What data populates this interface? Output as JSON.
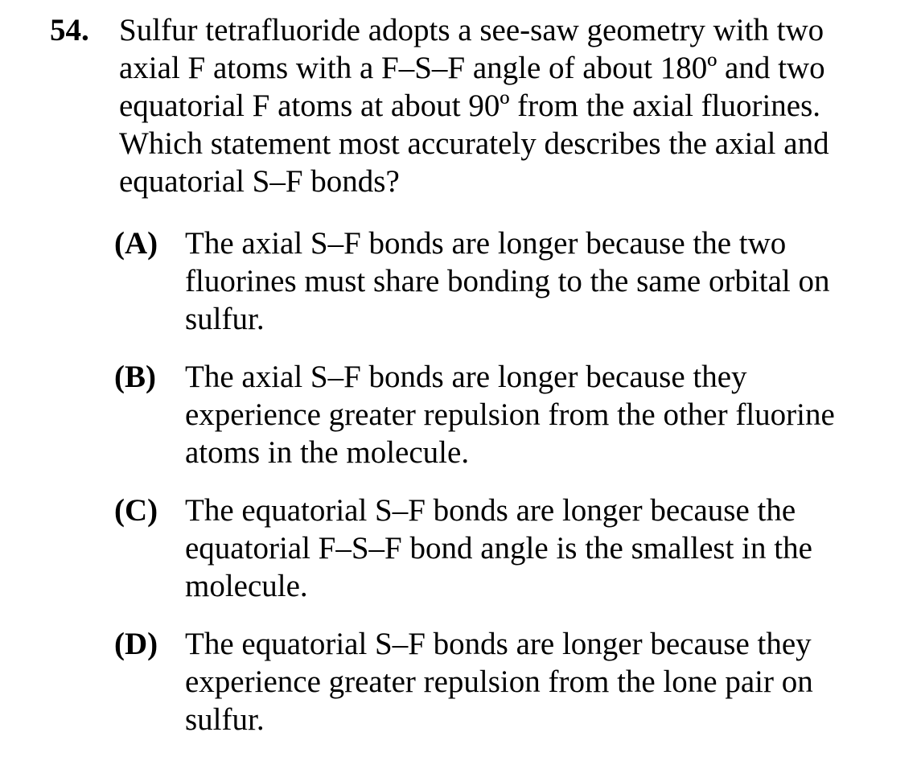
{
  "question": {
    "number": "54.",
    "stem_lines": [
      "Sulfur tetrafluoride adopts a see-saw geometry with two",
      "axial F atoms with a F–S–F angle of about 180º and two",
      "equatorial F atoms at about 90º from the axial fluorines.",
      "Which statement most accurately describes the axial and",
      "equatorial S–F bonds?"
    ]
  },
  "choices": [
    {
      "letter": "(A)",
      "lines": [
        "The axial S–F bonds are longer because the two",
        "fluorines must share bonding to the same orbital on",
        "sulfur."
      ]
    },
    {
      "letter": "(B)",
      "lines": [
        "The axial S–F bonds are longer because they",
        "experience greater repulsion from the other fluorine",
        "atoms in the molecule."
      ]
    },
    {
      "letter": "(C)",
      "lines": [
        "The equatorial S–F bonds are longer because the",
        "equatorial F–S–F bond angle is the smallest in the",
        "molecule."
      ]
    },
    {
      "letter": "(D)",
      "lines": [
        "The equatorial S–F bonds are longer because they",
        "experience greater repulsion from the lone pair on",
        "sulfur."
      ]
    }
  ]
}
